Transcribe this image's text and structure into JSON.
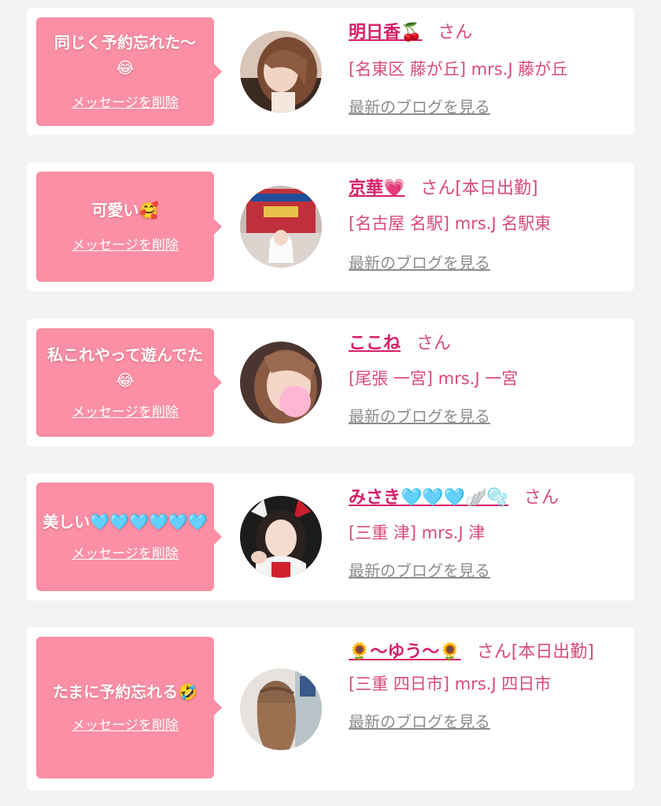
{
  "cards": [
    {
      "message": "同じく予約忘れた〜😂",
      "delete_label": "メッセージを削除",
      "name": "明日香🍒",
      "suffix": "さん",
      "area": "[名東区 藤が丘] mrs.J 藤が丘",
      "blog_label": "最新のブログを見る"
    },
    {
      "message": "可愛い🥰",
      "delete_label": "メッセージを削除",
      "name": "京華💗",
      "suffix": "さん[本日出勤]",
      "area": "[名古屋 名駅] mrs.J 名駅東",
      "blog_label": "最新のブログを見る"
    },
    {
      "message": "私これやって遊んでた😂",
      "delete_label": "メッセージを削除",
      "name": "ここね",
      "suffix": "さん",
      "area": "[尾張 一宮] mrs.J 一宮",
      "blog_label": "最新のブログを見る"
    },
    {
      "message": "美しい🩵🩵🩵🩵🩵🩵",
      "delete_label": "メッセージを削除",
      "name": "みさき🩵🩵🩵🪽🫧",
      "suffix": "さん",
      "area": "[三重 津] mrs.J 津",
      "blog_label": "最新のブログを見る"
    },
    {
      "message": "たまに予約忘れる🤣",
      "delete_label": "メッセージを削除",
      "name": "🌻〜ゆう〜🌻",
      "suffix": "さん[本日出勤]",
      "area": "[三重 四日市] mrs.J 四日市",
      "blog_label": "最新のブログを見る"
    }
  ],
  "colors": {
    "bubble": "#fa8fa5",
    "name": "#d61f69",
    "text_pink": "#d94a7a",
    "link_gray": "#8d8d8d",
    "background": "#f3f3f3"
  }
}
